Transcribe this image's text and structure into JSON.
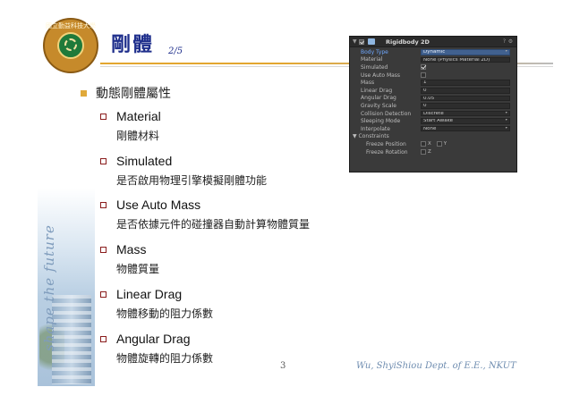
{
  "header": {
    "title": "剛體",
    "page_fraction": "2/5",
    "logo_text": "國立勤益科技大學"
  },
  "side": {
    "tagline": "shape the future"
  },
  "content": {
    "heading": "動態剛體屬性",
    "items": [
      {
        "label": "Material",
        "desc": "剛體材料"
      },
      {
        "label": "Simulated",
        "desc": "是否啟用物理引擎模擬剛體功能"
      },
      {
        "label": "Use Auto Mass",
        "desc": "是否依據元件的碰撞器自動計算物體質量"
      },
      {
        "label": "Mass",
        "desc": "物體質量"
      },
      {
        "label": "Linear Drag",
        "desc": "物體移動的阻力係數"
      },
      {
        "label": "Angular Drag",
        "desc": "物體旋轉的阻力係數"
      }
    ]
  },
  "footer": {
    "page_number": "3",
    "author": "Wu, ShyiShiou  Dept. of E.E., NKUT"
  },
  "inspector": {
    "component_title": "Rigidbody 2D",
    "component_enabled": true,
    "icons": {
      "collapse": "triangle-down-icon",
      "component": "rigidbody-icon",
      "help": "help-icon",
      "settings": "gear-icon"
    },
    "rows": [
      {
        "label": "Body Type",
        "value": "Dynamic",
        "kind": "dropdown",
        "selected": true
      },
      {
        "label": "Material",
        "value": "None (Physics Material 2D)",
        "kind": "object"
      },
      {
        "label": "Simulated",
        "checked": true,
        "kind": "checkbox"
      },
      {
        "label": "Use Auto Mass",
        "checked": false,
        "kind": "checkbox"
      },
      {
        "label": "Mass",
        "value": "1",
        "kind": "text"
      },
      {
        "label": "Linear Drag",
        "value": "0",
        "kind": "text"
      },
      {
        "label": "Angular Drag",
        "value": "0.05",
        "kind": "text"
      },
      {
        "label": "Gravity Scale",
        "value": "0",
        "kind": "text"
      },
      {
        "label": "Collision Detection",
        "value": "Discrete",
        "kind": "dropdown"
      },
      {
        "label": "Sleeping Mode",
        "value": "Start Awake",
        "kind": "dropdown"
      },
      {
        "label": "Interpolate",
        "value": "None",
        "kind": "dropdown"
      }
    ],
    "constraints": {
      "label": "Constraints",
      "freeze_position": {
        "label": "Freeze Position",
        "x": "X",
        "y": "Y"
      },
      "freeze_rotation": {
        "label": "Freeze Rotation",
        "z": "Z"
      }
    }
  }
}
